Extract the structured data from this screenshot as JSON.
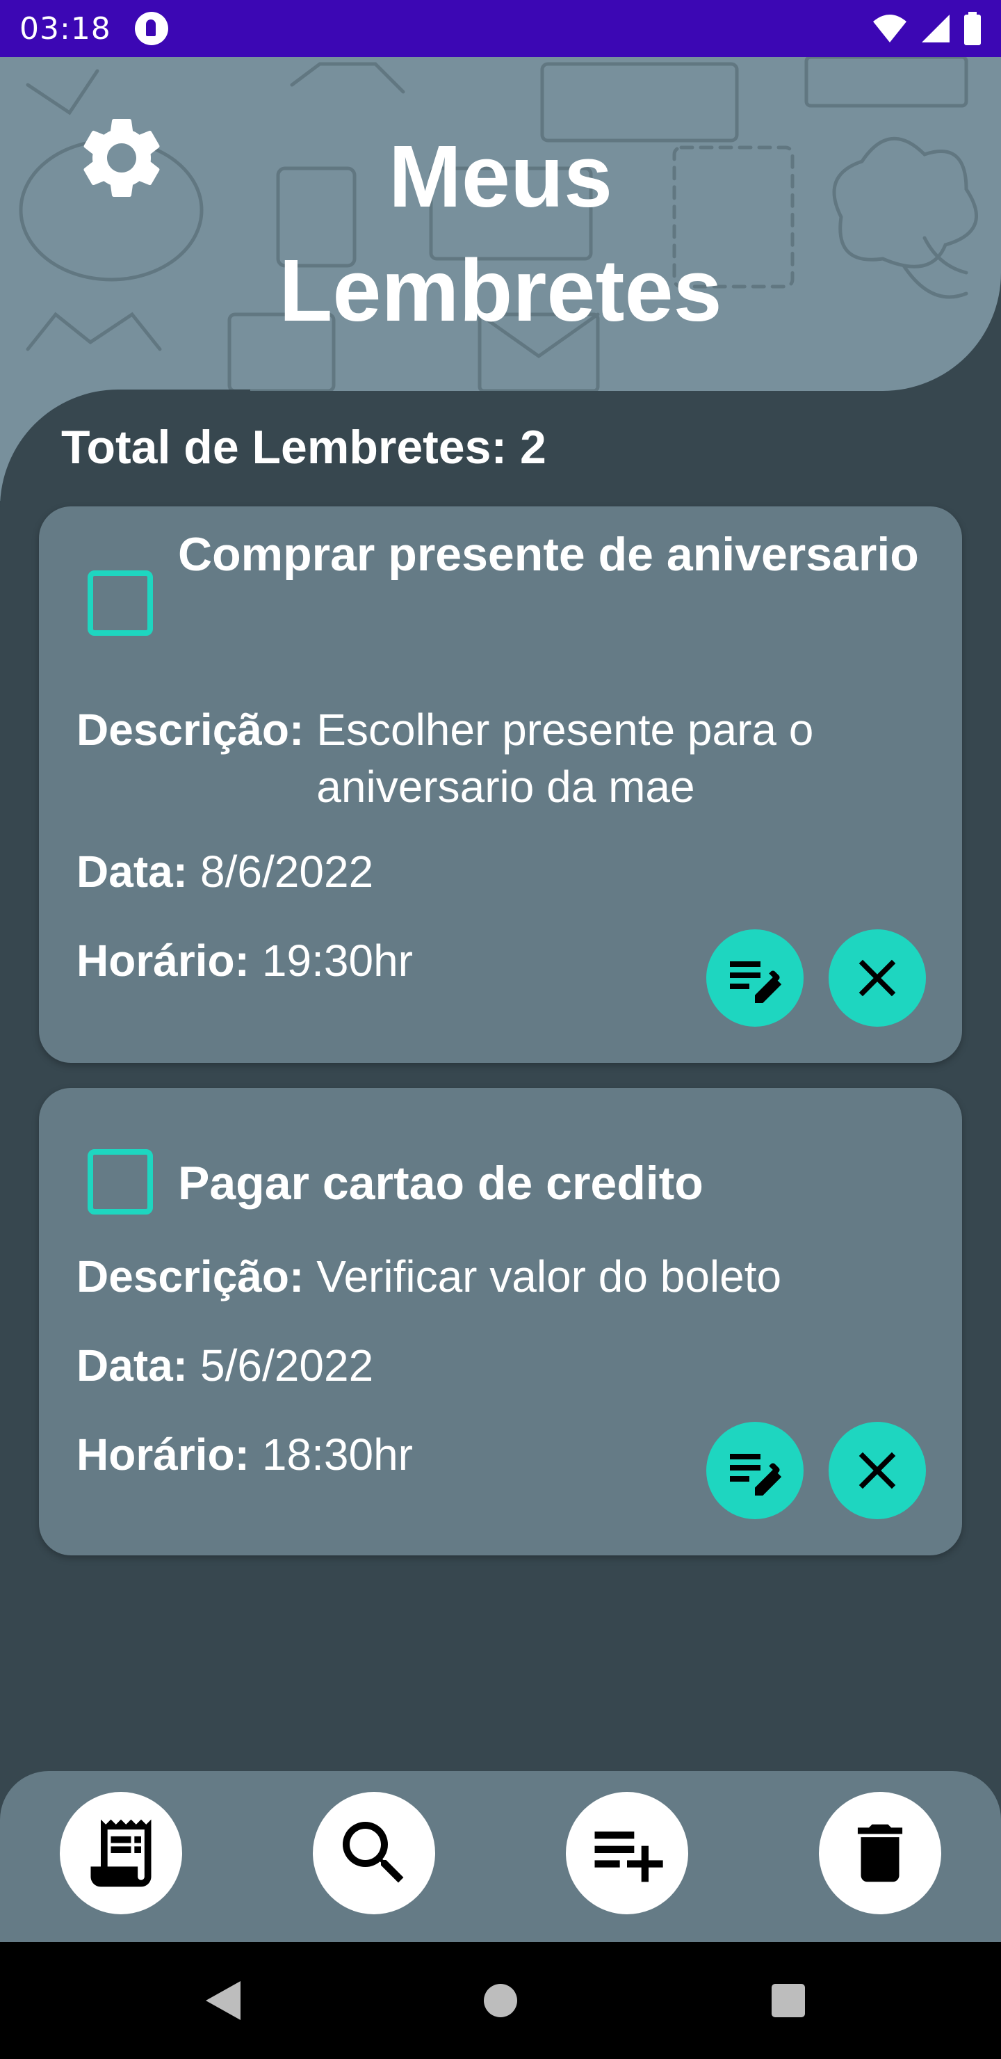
{
  "status_bar": {
    "time": "03:18",
    "icons": [
      "notification-icon",
      "wifi-icon",
      "signal-icon",
      "battery-icon"
    ]
  },
  "header": {
    "title_line1": "Meus",
    "title_line2": "Lembretes",
    "settings_icon": "gear-icon"
  },
  "summary": {
    "total_label": "Total de Lembretes: 2"
  },
  "labels": {
    "description": "Descrição:",
    "date": "Data:",
    "time": "Horário:"
  },
  "reminders": [
    {
      "title": "Comprar presente de aniversario",
      "description": "Escolher presente para o aniversario da mae",
      "date": "8/6/2022",
      "time": "19:30hr",
      "checked": false
    },
    {
      "title": "Pagar cartao de credito",
      "description": "Verificar valor do boleto",
      "date": "5/6/2022",
      "time": "18:30hr",
      "checked": false
    }
  ],
  "bottom_nav": [
    "receipt-icon",
    "search-icon",
    "playlist-add-icon",
    "trash-icon"
  ],
  "system_nav": [
    "back-icon",
    "home-icon",
    "recents-icon"
  ],
  "colors": {
    "status_bar": "#3c07b4",
    "header": "#78909c",
    "background": "#37474f",
    "card": "#657b86",
    "accent": "#1ed6c0"
  }
}
